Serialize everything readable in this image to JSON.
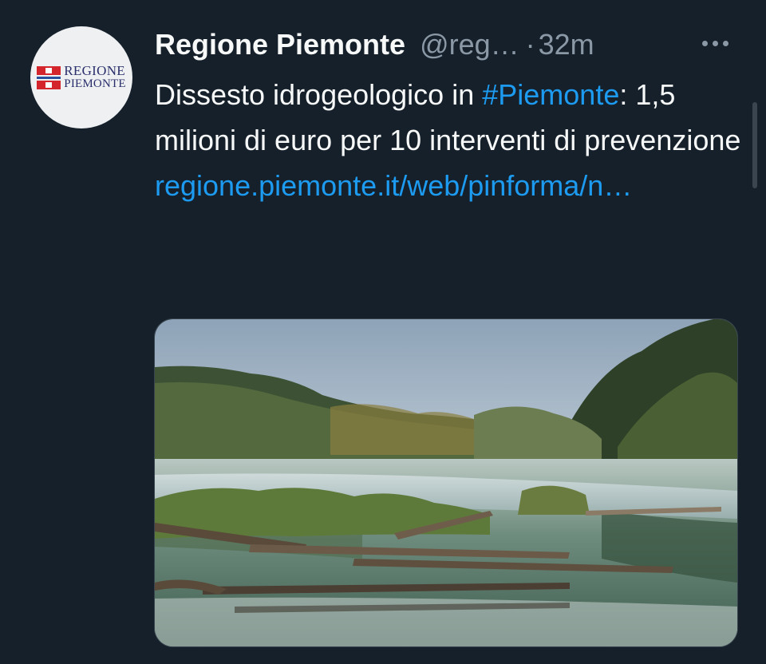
{
  "author": {
    "display_name": "Regione Piemonte",
    "handle": "@reg…",
    "separator": "·",
    "time": "32m",
    "avatar_logo": {
      "line1": "REGIONE",
      "line2": "PIEMONTE"
    }
  },
  "menu": {
    "icon": "more-horizontal-icon"
  },
  "tweet": {
    "text_before": "Dissesto idrogeologico in ",
    "hashtag": "#Piemonte",
    "text_after": ": 1,5 milioni di euro per 10 interventi di prevenzione ",
    "link": "regione.piemonte.it/web/pinforma/n…"
  },
  "colors": {
    "background": "#15202b",
    "text": "#f7f9f9",
    "secondary": "#8b98a5",
    "accent": "#1d9bf0"
  }
}
